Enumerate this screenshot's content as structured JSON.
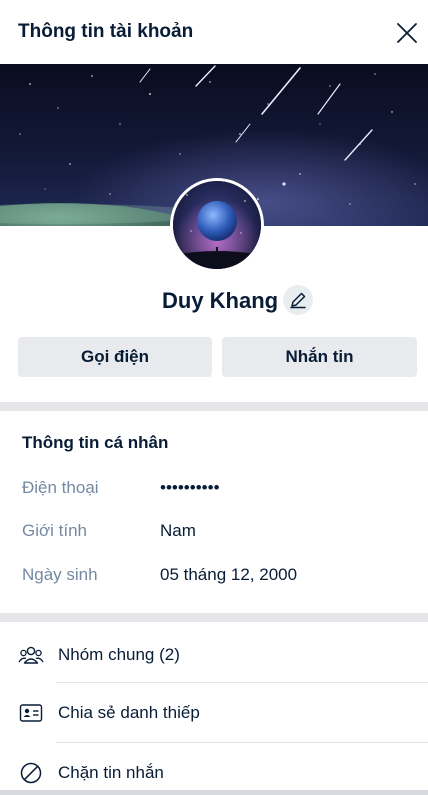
{
  "header": {
    "title": "Thông tin tài khoản",
    "close_icon": "close-icon"
  },
  "profile": {
    "name": "Duy Khang",
    "edit_icon": "pencil-icon"
  },
  "actions": {
    "call_label": "Gọi điện",
    "message_label": "Nhắn tin"
  },
  "personal_info": {
    "title": "Thông tin cá nhân",
    "rows": [
      {
        "label": "Điện thoại",
        "value": "••••••••••"
      },
      {
        "label": "Giới tính",
        "value": "Nam"
      },
      {
        "label": "Ngày sinh",
        "value": "05 tháng 12, 2000"
      }
    ]
  },
  "menu": [
    {
      "label": "Nhóm chung (2)",
      "icon": "group-icon"
    },
    {
      "label": "Chia sẻ danh thiếp",
      "icon": "contact-card-icon"
    },
    {
      "label": "Chặn tin nhắn",
      "icon": "block-icon"
    }
  ],
  "colors": {
    "text": "#081c36",
    "muted": "#7589a3",
    "button_bg": "#e8eaee",
    "divider": "#e4e6ea"
  }
}
